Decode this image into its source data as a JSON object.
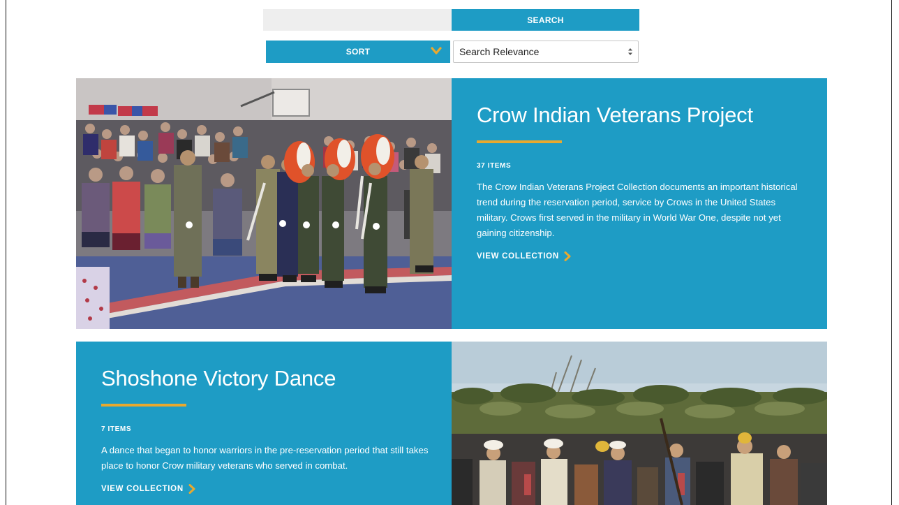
{
  "search": {
    "placeholder": "",
    "button_label": "SEARCH"
  },
  "sort": {
    "button_label": "SORT",
    "selected": "Search Relevance"
  },
  "collections": [
    {
      "title": "Crow Indian Veterans Project",
      "count": "37 ITEMS",
      "description": "The Crow Indian Veterans Project Collection documents an important historical trend during the reservation period, service by Crows in the United States military. Crows first served in the military in World War One, despite not yet gaining citizenship.",
      "link_label": "VIEW COLLECTION"
    },
    {
      "title": "Shoshone Victory Dance",
      "count": "7 ITEMS",
      "description": "A dance that began to honor warriors in the pre-reservation period that still takes place to honor Crow military veterans who served in combat.",
      "link_label": "VIEW COLLECTION"
    }
  ],
  "colors": {
    "accent": "#1e9cc5",
    "rule": "#e8a92f"
  },
  "icons": {
    "sort": "chevron-down-icon",
    "link": "chevron-right-icon",
    "select": "select-arrows-icon"
  }
}
